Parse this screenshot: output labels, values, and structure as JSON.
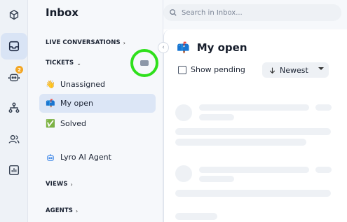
{
  "app": {
    "title": "Inbox"
  },
  "search": {
    "placeholder": "Search in Inbox..."
  },
  "rail": {
    "items": [
      {
        "name": "logo",
        "icon": "hexagon-logo-icon"
      },
      {
        "name": "inbox",
        "icon": "inbox-tray-icon",
        "active": true
      },
      {
        "name": "bot",
        "icon": "bot-face-icon",
        "badge": "2"
      },
      {
        "name": "flows",
        "icon": "flow-tree-icon"
      },
      {
        "name": "contacts",
        "icon": "users-icon"
      },
      {
        "name": "analytics",
        "icon": "bar-chart-icon"
      }
    ]
  },
  "sidebar": {
    "live_conversations": "LIVE CONVERSATIONS",
    "tickets": "TICKETS",
    "items": [
      {
        "label": "Unassigned",
        "emoji": "👋"
      },
      {
        "label": "My open",
        "emoji": "📫"
      },
      {
        "label": "Solved",
        "emoji": "✅"
      }
    ],
    "lyro": "Lyro AI Agent",
    "views": "VIEWS",
    "agents": "AGENTS"
  },
  "main": {
    "emoji": "📫",
    "title": "My open",
    "show_pending": "Show pending",
    "sort_label": "Newest"
  },
  "colors": {
    "accent": "#dce6f6",
    "highlight_ring": "#2fe01c",
    "badge": "#f3a623"
  }
}
